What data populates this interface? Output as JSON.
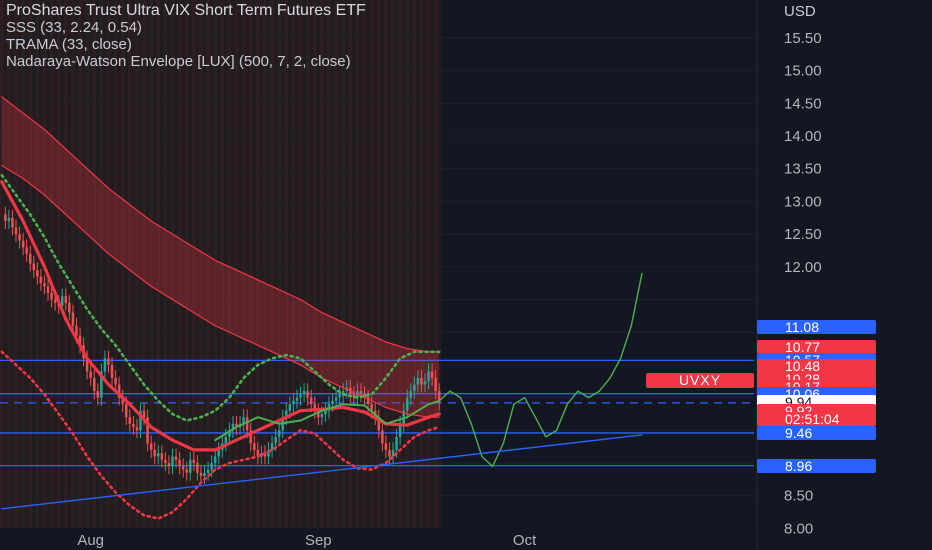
{
  "legend": {
    "title": "ProShares Trust Ultra VIX Short Term Futures ETF",
    "lines": [
      "SSS (33, 2.24, 0.54)",
      "TRAMA (33, close)",
      "Nadaraya-Watson Envelope [LUX] (500, 7, 2, close)"
    ]
  },
  "currency_label": "USD",
  "symbol_tag": "UVXY",
  "price_tags": [
    {
      "label": "11.08",
      "price": 11.08,
      "color": "#2962ff"
    },
    {
      "label": "10.77",
      "price": 10.77,
      "color": "#f23645"
    },
    {
      "label": "10.57",
      "price": 10.57,
      "color": "#2962ff"
    },
    {
      "label": "10.48",
      "price": 10.48,
      "color": "#f23645"
    },
    {
      "label": "10.28",
      "price": 10.28,
      "color": "#f23645"
    },
    {
      "label": "10.17",
      "price": 10.17,
      "color": "#f23645"
    },
    {
      "label": "10.06",
      "price": 10.06,
      "color": "#2962ff"
    },
    {
      "label": "9.94",
      "price": 9.94,
      "color": "#ffffff"
    },
    {
      "label": "9.92",
      "price": 9.8,
      "color": "#f23645"
    },
    {
      "label": "02:51:04",
      "price": 9.675,
      "color": "#f23645"
    },
    {
      "label": "9.46",
      "price": 9.46,
      "color": "#2962ff"
    },
    {
      "label": "8.96",
      "price": 8.96,
      "color": "#2962ff"
    }
  ],
  "chart_data": {
    "type": "line",
    "ylim": [
      7.67,
      16.08
    ],
    "y_ticks": [
      8.0,
      8.5,
      9.0,
      9.5,
      10.0,
      10.5,
      11.0,
      11.5,
      12.0,
      12.5,
      13.0,
      13.5,
      14.0,
      14.5,
      15.0,
      15.5
    ],
    "y_tick_labels": [
      "8.00",
      "8.50",
      "",
      "",
      "",
      "",
      "",
      "",
      "12.00",
      "12.50",
      "13.00",
      "13.50",
      "14.00",
      "14.50",
      "15.00",
      "15.50"
    ],
    "x_labels": [
      {
        "label": "Aug",
        "index": 25
      },
      {
        "label": "Sep",
        "index": 89
      },
      {
        "label": "Oct",
        "index": 147
      }
    ],
    "total_bars": 212,
    "last_bar_index": 123,
    "horizontal_levels": [
      10.57,
      10.06,
      9.46,
      8.96
    ],
    "current_price": 9.92,
    "close_prices": [
      12.8,
      12.7,
      12.75,
      12.6,
      12.5,
      12.4,
      12.3,
      12.2,
      12.05,
      11.95,
      11.85,
      11.75,
      11.7,
      11.6,
      11.5,
      11.45,
      11.4,
      11.55,
      11.45,
      11.3,
      11.1,
      10.95,
      10.8,
      10.6,
      10.4,
      10.3,
      10.1,
      10.0,
      10.4,
      10.6,
      10.5,
      10.3,
      10.2,
      10.0,
      9.9,
      9.7,
      9.6,
      9.55,
      9.5,
      9.8,
      9.7,
      9.3,
      9.2,
      9.1,
      9.15,
      9.05,
      9.0,
      8.95,
      9.1,
      9.05,
      8.95,
      8.9,
      8.85,
      9.05,
      9.0,
      8.85,
      8.8,
      8.85,
      8.9,
      9.0,
      9.1,
      9.2,
      9.3,
      9.4,
      9.5,
      9.6,
      9.55,
      9.6,
      9.7,
      9.5,
      9.3,
      9.2,
      9.1,
      9.15,
      9.1,
      9.2,
      9.3,
      9.4,
      9.5,
      9.7,
      9.8,
      9.9,
      9.95,
      10.0,
      10.05,
      10.1,
      10.0,
      9.9,
      9.8,
      9.7,
      9.75,
      9.8,
      9.9,
      9.95,
      10.0,
      10.05,
      10.1,
      10.15,
      10.05,
      10.0,
      10.1,
      10.05,
      10.0,
      9.9,
      9.8,
      9.7,
      9.5,
      9.3,
      9.2,
      9.1,
      9.2,
      9.4,
      9.6,
      9.8,
      10.0,
      10.1,
      10.2,
      10.3,
      10.2,
      10.25,
      10.4,
      10.3,
      10.1,
      9.92
    ],
    "series": [
      {
        "color": "#f23645",
        "x": [
          0,
          6,
          12,
          18,
          24,
          30,
          36,
          42,
          48,
          54,
          60,
          66,
          72,
          78,
          84,
          90,
          96,
          102,
          108,
          114,
          120,
          123
        ],
        "y": [
          13.55,
          13.35,
          13.1,
          12.8,
          12.5,
          12.2,
          11.95,
          11.7,
          11.5,
          11.3,
          11.1,
          10.95,
          10.8,
          10.65,
          10.5,
          10.3,
          10.15,
          10.0,
          9.85,
          9.75,
          9.7,
          9.7
        ]
      },
      {
        "color": "#f23645",
        "x": [
          0,
          6,
          12,
          18,
          24,
          30,
          36,
          42,
          48,
          54,
          60,
          66,
          72,
          78,
          84,
          90,
          96,
          102,
          108,
          114,
          120,
          123
        ],
        "y": [
          14.6,
          14.35,
          14.1,
          13.8,
          13.5,
          13.2,
          12.95,
          12.7,
          12.5,
          12.3,
          12.1,
          11.95,
          11.8,
          11.65,
          11.5,
          11.3,
          11.15,
          11.0,
          10.85,
          10.75,
          10.7,
          10.7
        ]
      },
      {
        "color": "#f23645",
        "x": [
          0,
          4,
          8,
          12,
          16,
          20,
          24,
          28,
          32,
          36,
          40,
          44,
          48,
          52,
          56,
          60,
          64,
          68,
          72,
          76,
          80,
          84,
          88,
          92,
          96,
          100,
          104,
          108,
          112,
          116,
          120,
          123
        ],
        "y": [
          10.7,
          10.5,
          10.3,
          10.05,
          9.75,
          9.45,
          9.1,
          8.8,
          8.55,
          8.35,
          8.2,
          8.15,
          8.25,
          8.45,
          8.7,
          8.9,
          9.0,
          9.05,
          9.1,
          9.2,
          9.35,
          9.5,
          9.45,
          9.25,
          9.05,
          8.92,
          8.9,
          9.0,
          9.2,
          9.4,
          9.5,
          9.55
        ]
      },
      {
        "color": "#4caf50",
        "x": [
          0,
          4,
          8,
          12,
          16,
          20,
          24,
          28,
          32,
          36,
          40,
          44,
          48,
          52,
          56,
          60,
          64,
          68,
          72,
          76,
          80,
          84,
          88,
          92,
          96,
          100,
          104,
          108,
          112,
          116,
          120,
          123
        ],
        "y": [
          13.4,
          13.1,
          12.8,
          12.45,
          12.05,
          11.7,
          11.35,
          11.05,
          10.8,
          10.5,
          10.2,
          9.95,
          9.75,
          9.65,
          9.7,
          9.8,
          10.0,
          10.3,
          10.5,
          10.6,
          10.65,
          10.6,
          10.4,
          10.2,
          10.05,
          10.0,
          10.05,
          10.3,
          10.6,
          10.7,
          10.7,
          10.7
        ]
      },
      {
        "color": "#f23645",
        "x": [
          0,
          6,
          12,
          18,
          24,
          30,
          36,
          42,
          48,
          54,
          60,
          66,
          72,
          78,
          84,
          90,
          96,
          102,
          108,
          114,
          120,
          123
        ],
        "y": [
          13.3,
          12.7,
          12.0,
          11.2,
          10.6,
          10.2,
          9.9,
          9.55,
          9.35,
          9.2,
          9.2,
          9.35,
          9.5,
          9.65,
          9.8,
          9.82,
          9.85,
          9.78,
          9.6,
          9.58,
          9.7,
          9.75
        ]
      },
      {
        "color": "#4caf50",
        "x": [
          60,
          66,
          72,
          78,
          84,
          90,
          96,
          102,
          108,
          114,
          120,
          123
        ],
        "y": [
          9.35,
          9.55,
          9.7,
          9.6,
          9.65,
          9.8,
          9.9,
          9.88,
          9.6,
          9.7,
          9.9,
          9.95
        ]
      },
      {
        "color": "#4caf50",
        "x": [
          123,
          126,
          129,
          132,
          135,
          138,
          141,
          144,
          147,
          150,
          153,
          156,
          159,
          162,
          165,
          168,
          171,
          174,
          177,
          180
        ],
        "y": [
          9.95,
          10.1,
          10.0,
          9.6,
          9.1,
          8.95,
          9.3,
          9.9,
          10.0,
          9.7,
          9.4,
          9.5,
          9.9,
          10.1,
          10.0,
          10.1,
          10.3,
          10.6,
          11.1,
          11.9
        ]
      },
      {
        "color": "#2962ff",
        "x": [
          0,
          180
        ],
        "y": [
          8.3,
          9.43
        ]
      }
    ]
  }
}
